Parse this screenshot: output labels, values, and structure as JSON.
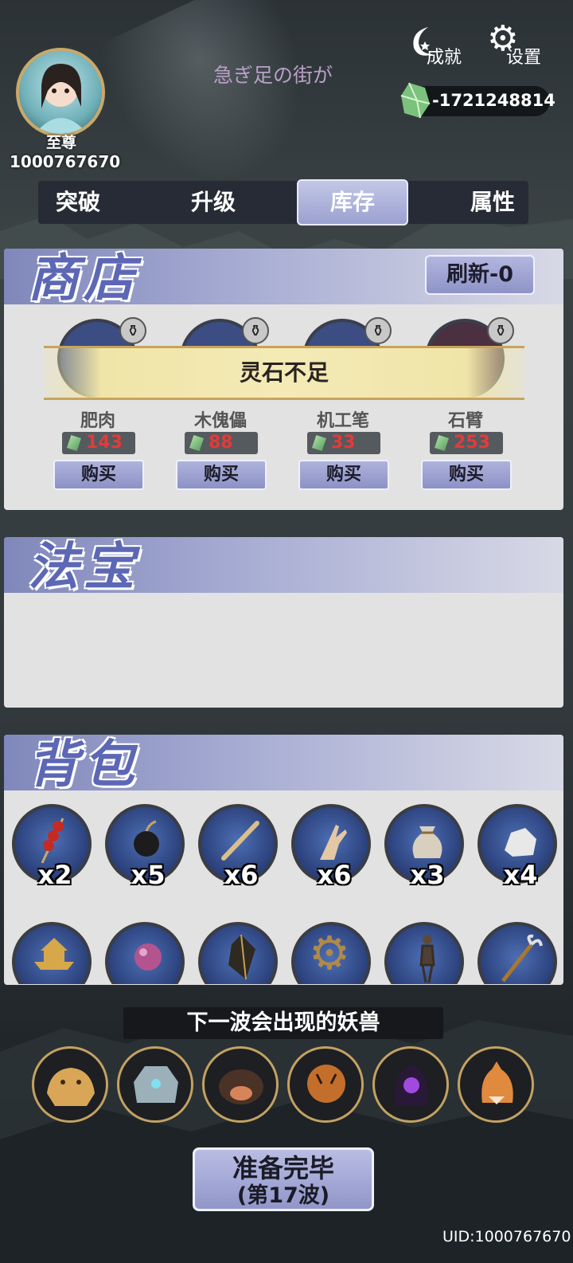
{
  "header": {
    "rank": "至尊",
    "user_id": "1000767670",
    "subtitle": "急ぎ足の街が",
    "achievements_label": "成就",
    "settings_label": "设置",
    "spirit_stones": "-1721248814"
  },
  "tabs": [
    {
      "label": "突破",
      "active": false
    },
    {
      "label": "升级",
      "active": false
    },
    {
      "label": "库存",
      "active": true
    },
    {
      "label": "属性",
      "active": false
    }
  ],
  "shop": {
    "title": "商店",
    "refresh_label": "刷新-0",
    "toast": "灵石不足",
    "items": [
      {
        "name": "肥肉",
        "price": "143",
        "buy": "购买"
      },
      {
        "name": "木傀儡",
        "price": "88",
        "buy": "购买"
      },
      {
        "name": "机工笔",
        "price": "33",
        "buy": "购买"
      },
      {
        "name": "石臂",
        "price": "253",
        "buy": "购买"
      }
    ]
  },
  "treasure": {
    "title": "法宝"
  },
  "backpack": {
    "title": "背包",
    "row1": [
      {
        "icon": "candied-haws-icon",
        "count": "x2"
      },
      {
        "icon": "bomb-icon",
        "count": "x5"
      },
      {
        "icon": "brush-icon",
        "count": "x6"
      },
      {
        "icon": "hand-icon",
        "count": "x6"
      },
      {
        "icon": "pouch-icon",
        "count": "x3"
      },
      {
        "icon": "rock-icon",
        "count": "x4"
      }
    ],
    "row2": [
      {
        "icon": "pagoda-icon"
      },
      {
        "icon": "pearl-icon"
      },
      {
        "icon": "crystal-icon"
      },
      {
        "icon": "gear-icon"
      },
      {
        "icon": "puppet-icon"
      },
      {
        "icon": "claw-staff-icon"
      }
    ]
  },
  "next_wave": {
    "label": "下一波会出现的妖兽",
    "monsters": [
      "leopard-icon",
      "rock-golem-icon",
      "boar-icon",
      "tiger-icon",
      "shadow-wraith-icon",
      "fox-icon"
    ]
  },
  "ready": {
    "line1": "准备完毕",
    "line2": "(第17波)"
  },
  "footer": {
    "uid": "UID:1000767670"
  },
  "colors": {
    "accent": "#9ba1d0",
    "panel": "#e2e2e2",
    "price": "#e23b3b",
    "gold": "#c9a86a"
  }
}
